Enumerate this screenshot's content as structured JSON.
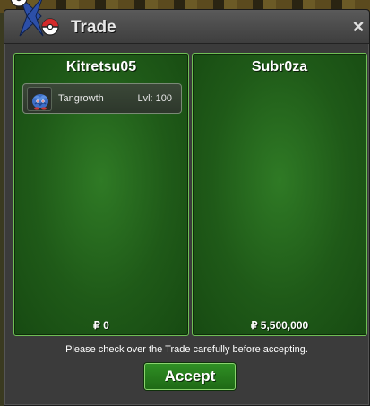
{
  "window": {
    "title": "Trade",
    "close_label": "×",
    "icons": {
      "logo": "pokeball-logo-icon",
      "close": "close-icon"
    }
  },
  "left_panel": {
    "player_name": "Kitretsu05",
    "money": "₽ 0",
    "items": [
      {
        "icon": "tangrowth-sprite-icon",
        "name": "Tangrowth",
        "level": "Lvl: 100"
      }
    ]
  },
  "right_panel": {
    "player_name": "Subr0za",
    "money": "₽ 5,500,000",
    "items": []
  },
  "notice": "Please check over the Trade carefully before accepting.",
  "accept_label": "Accept",
  "colors": {
    "panel_green": "#1f5a18",
    "panel_border": "#6fbf55",
    "button_green": "#2f8f24",
    "titlebar": "#4a4a4a"
  }
}
